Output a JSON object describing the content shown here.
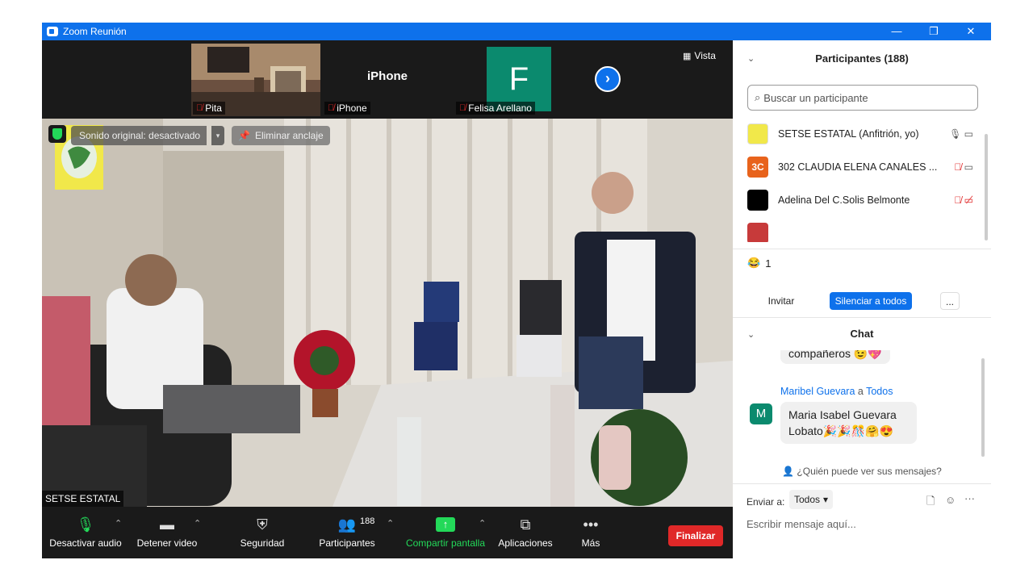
{
  "window": {
    "title": "Zoom Reunión",
    "minimize": "—",
    "restore": "❐",
    "close": "✕"
  },
  "strip": {
    "tiles": [
      {
        "name": "Pita"
      },
      {
        "name": "iPhone",
        "big_label": "iPhone"
      },
      {
        "name": "Felisa Arellano",
        "initial": "F"
      }
    ],
    "view_label": "Vista"
  },
  "stage": {
    "original_sound": "Sonido original: desactivado",
    "unpin": "Eliminar anclaje",
    "speaker_name": "SETSE ESTATAL"
  },
  "toolbar": {
    "mute": "Desactivar audio",
    "video": "Detener video",
    "security": "Seguridad",
    "participants": "Participantes",
    "participants_count": "188",
    "share": "Compartir pantalla",
    "apps": "Aplicaciones",
    "more": "Más",
    "end": "Finalizar"
  },
  "participants_panel": {
    "title": "Participantes (188)",
    "search_placeholder": "Buscar un participante",
    "rows": [
      {
        "name": "SETSE ESTATAL (Anfitrión, yo)",
        "avatar": ""
      },
      {
        "name": "302 CLAUDIA ELENA CANALES ...",
        "avatar": "3C"
      },
      {
        "name": "Adelina Del C.Solis Belmonte",
        "avatar": ""
      }
    ],
    "reaction_emoji": "😂",
    "reaction_count": "1",
    "invite": "Invitar",
    "mute_all": "Silenciar a todos",
    "more": "..."
  },
  "chat": {
    "title": "Chat",
    "prev_message": "compañeros 😉💖",
    "sender": "Maribel Guevara",
    "to_word": "a",
    "recipient": "Todos",
    "avatar": "M",
    "message": "Maria Isabel Guevara Lobato🎉🎉🎊🤗😍",
    "who_sees": "¿Quién puede ver sus mensajes?",
    "send_to_label": "Enviar a:",
    "send_to_value": "Todos",
    "input_placeholder": "Escribir mensaje aquí..."
  },
  "colors": {
    "zoom_blue": "#0e71eb",
    "end_red": "#e02828",
    "share_green": "#23d959"
  }
}
